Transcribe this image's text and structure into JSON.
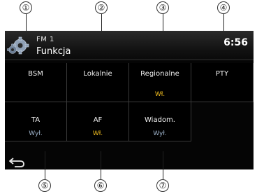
{
  "callouts": [
    "①",
    "②",
    "③",
    "④",
    "⑤",
    "⑥",
    "⑦"
  ],
  "header": {
    "source": "FM  1",
    "title": "Funkcja",
    "clock": "6:56"
  },
  "buttons": [
    {
      "label": "BSM",
      "value": ""
    },
    {
      "label": "Lokalnie",
      "value": ""
    },
    {
      "label": "Regionalne",
      "value": "Wł.",
      "state": "on"
    },
    {
      "label": "PTY",
      "value": ""
    },
    {
      "label": "TA",
      "value": "Wył.",
      "state": "off"
    },
    {
      "label": "AF",
      "value": "Wł.",
      "state": "on"
    },
    {
      "label": "Wiadom.",
      "value": "Wył.",
      "state": "off"
    }
  ],
  "icons": {
    "settings": "gear-icon",
    "back": "back-arrow-icon"
  },
  "colors": {
    "on": "#f4c020",
    "off": "#9fb4cc",
    "background": "#050505"
  }
}
